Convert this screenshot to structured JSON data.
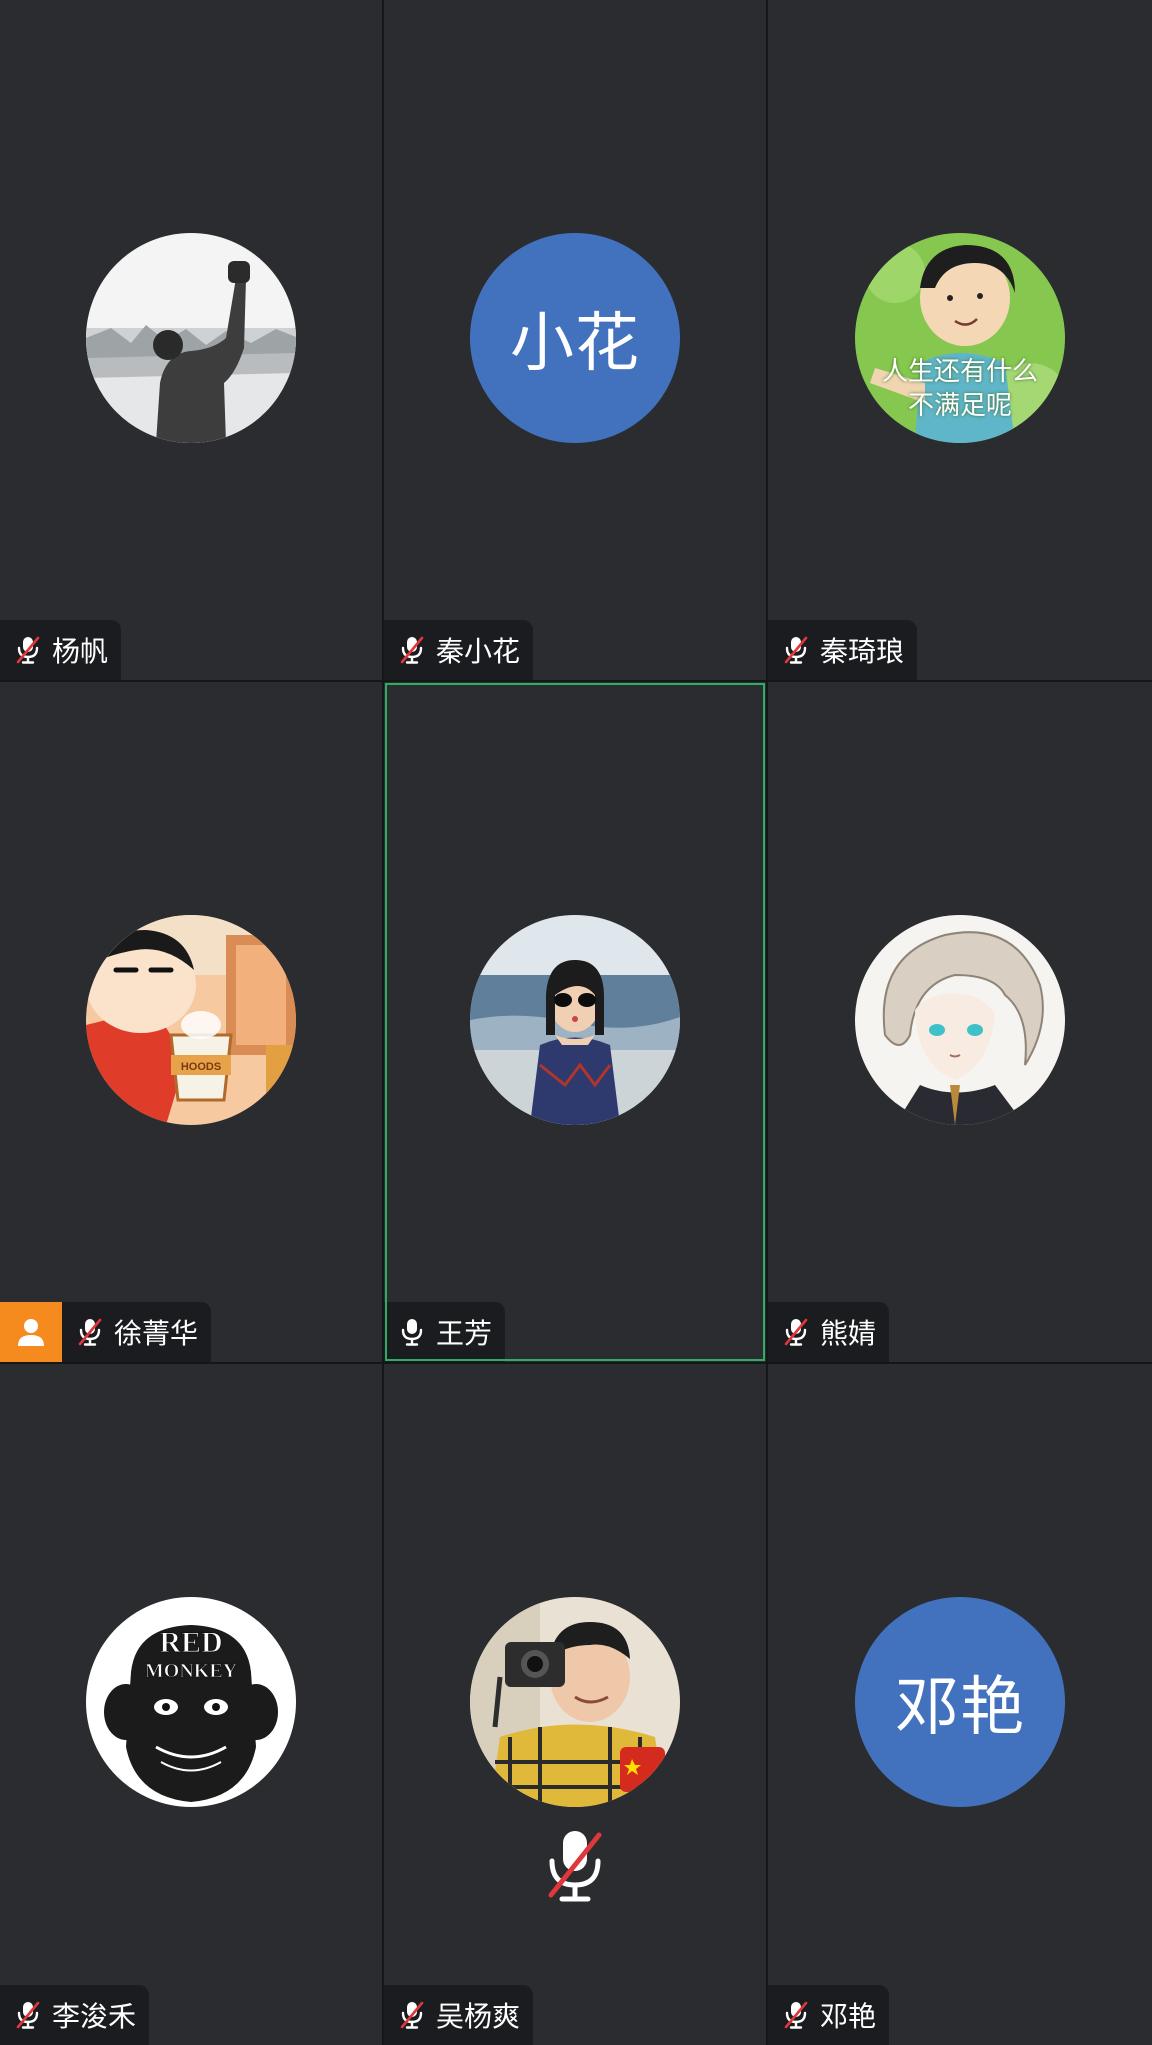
{
  "participants": [
    {
      "name": "杨帆",
      "mic": "muted",
      "avatar": "photo-raised-fist"
    },
    {
      "name": "秦小花",
      "mic": "muted",
      "avatar": "text",
      "avatar_text": "小花",
      "avatar_color": "#4272be"
    },
    {
      "name": "秦琦琅",
      "mic": "muted",
      "avatar": "meme-cartoon-boy",
      "avatar_caption_line1": "人生还有什么",
      "avatar_caption_line2": "不满足呢"
    },
    {
      "name": "徐菁华",
      "mic": "muted",
      "avatar": "cartoon-crayon-shin",
      "host_badge": "user-icon",
      "cup_text": "HOODS"
    },
    {
      "name": "王芳",
      "mic": "on",
      "avatar": "photo-beach-woman",
      "active_speaker": true,
      "active_color": "#2fae63"
    },
    {
      "name": "熊婧",
      "mic": "muted",
      "avatar": "anime-character"
    },
    {
      "name": "李浚禾",
      "mic": "muted",
      "avatar": "red-monkey-logo",
      "logo_text_1": "RED",
      "logo_text_2": "MONKEY"
    },
    {
      "name": "吴杨爽",
      "mic": "muted",
      "avatar": "photo-man-camera",
      "center_icon": "mic-off-icon"
    },
    {
      "name": "邓艳",
      "mic": "muted",
      "avatar": "text",
      "avatar_text": "邓艳",
      "avatar_color": "#4272be"
    }
  ],
  "colors": {
    "tile_bg": "#2a2c30",
    "nametag_bg": "#1b1c1f",
    "host_badge": "#f58a1f",
    "muted_slash": "#e0373a"
  }
}
